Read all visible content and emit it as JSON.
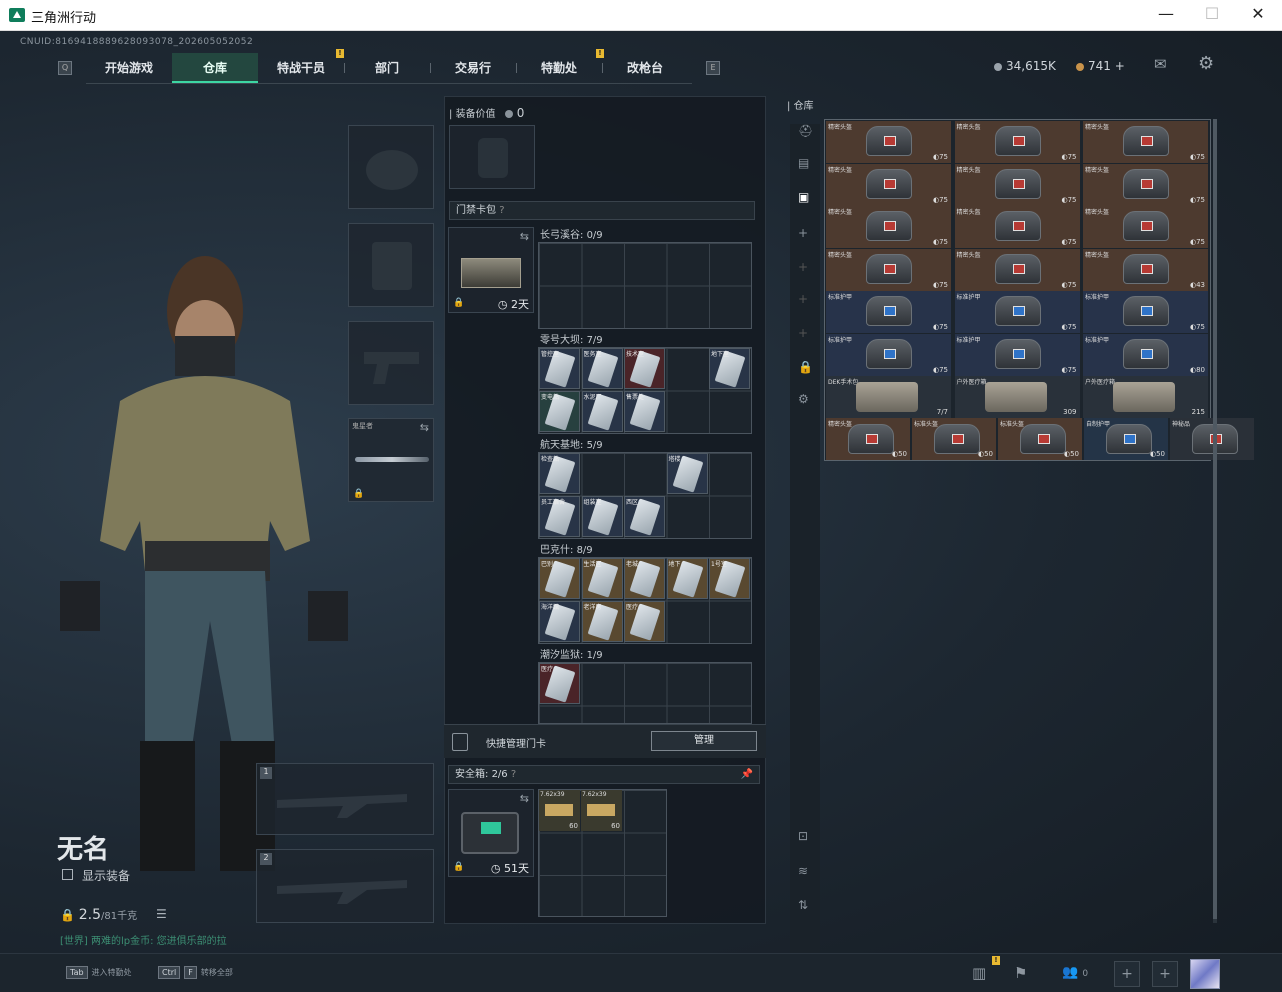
{
  "window": {
    "title": "三角洲行动",
    "minimize": "—",
    "maximize": "☐",
    "close": "✕"
  },
  "uid": "CNUID:8169418889628093078_202605052052",
  "nav": {
    "tabs": [
      "开始游戏",
      "仓库",
      "特战干员",
      "部门",
      "交易行",
      "特勤处",
      "改枪台"
    ],
    "active": "仓库",
    "key_left": "Q",
    "key_right": "E"
  },
  "currency": {
    "coins": "34,615K",
    "tickets": "741",
    "plus": "+"
  },
  "character": {
    "name": "无名",
    "show_equipment": "显示装备",
    "weight": "2.5",
    "weight_max": "/81千克",
    "chat": "[世界] 两难的lp金币: 您进俱乐部的拉"
  },
  "equipment": {
    "knife_label": "鬼星者",
    "slot1": "1",
    "slot2": "2"
  },
  "middle": {
    "equip_value_label": "装备价值",
    "equip_value": "0",
    "keycard_header": "门禁卡包",
    "keycard_days": "2天",
    "quick_manage": "快捷管理门卡",
    "manage_btn": "管理",
    "safebox_label": "安全箱:",
    "safebox_value": "2/6",
    "safebox_days": "51天"
  },
  "maps": [
    {
      "name": "长弓溪谷",
      "count": "0/9"
    },
    {
      "name": "零号大坝",
      "count": "7/9"
    },
    {
      "name": "航天基地",
      "count": "5/9"
    },
    {
      "name": "巴克什",
      "count": "8/9"
    },
    {
      "name": "潮汐监狱",
      "count": "1/9"
    }
  ],
  "card_labels": {
    "m1": [
      "管控室",
      "医务室",
      "技术室",
      "",
      "地下室",
      "",
      "变电站",
      "水泥厂",
      "售票处"
    ],
    "m2": [
      "检查站",
      "",
      "",
      "",
      "塔楼",
      "",
      "员工宿舍",
      "组装室",
      "西区"
    ],
    "m3": [
      "巴别",
      "生活区",
      "老城",
      "地下",
      "1号室",
      "海洋馆",
      "老洋房",
      "医疗"
    ],
    "m4": [
      "医疗"
    ]
  },
  "ammo": [
    {
      "label": "7.62x39",
      "count": "60"
    },
    {
      "label": "7.62x39",
      "count": "60"
    }
  ],
  "warehouse": {
    "title": "仓库",
    "helmet_label": "精密头盔",
    "vest_label": "标准护甲",
    "rows": [
      [
        "75",
        "75",
        "75"
      ],
      [
        "75",
        "75",
        "75"
      ],
      [
        "75",
        "75",
        "75"
      ],
      [
        "75",
        "75",
        "43"
      ],
      [
        "75",
        "75",
        "75"
      ],
      [
        "75",
        "75",
        "80"
      ]
    ],
    "special": [
      {
        "label": "DEK手术包",
        "count": "7/7"
      },
      {
        "label": "户外医疗箱",
        "count": "309"
      },
      {
        "label": "户外医疗箱",
        "count": "215"
      }
    ],
    "lastrow": [
      {
        "label": "精密头盔",
        "count": "50"
      },
      {
        "label": "标准头盔",
        "count": "50"
      },
      {
        "label": "标准头盔",
        "count": "50"
      },
      {
        "label": "自制护甲",
        "count": "50"
      },
      {
        "label": "神秘品",
        "count": ""
      }
    ]
  },
  "bottom": {
    "hint1_key": "Tab",
    "hint1": "进入特勤处",
    "hint2_key": "Ctrl",
    "hint2_key2": "F",
    "hint2": "转移全部",
    "friends": "0"
  }
}
